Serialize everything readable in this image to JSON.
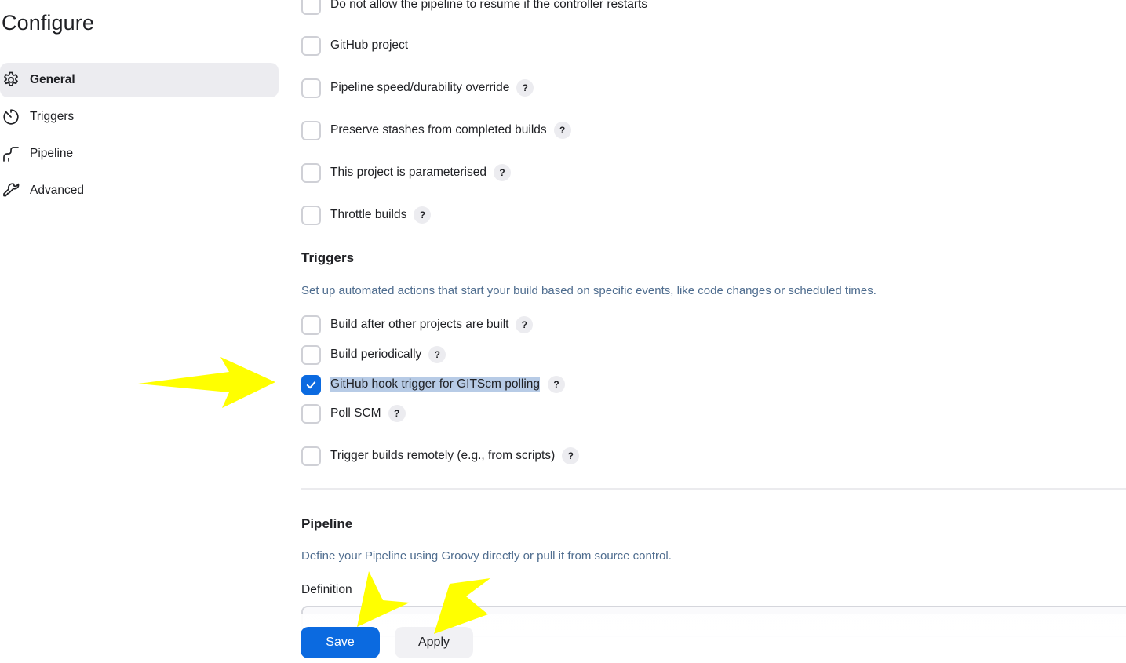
{
  "page": {
    "title": "Configure"
  },
  "sidebar": {
    "items": [
      {
        "label": "General",
        "icon": "gear-icon",
        "active": true
      },
      {
        "label": "Triggers",
        "icon": "timer-icon",
        "active": false
      },
      {
        "label": "Pipeline",
        "icon": "pipeline-icon",
        "active": false
      },
      {
        "label": "Advanced",
        "icon": "wrench-icon",
        "active": false
      }
    ]
  },
  "general": {
    "options": [
      {
        "label": "Do not allow the pipeline to resume if the controller restarts",
        "checked": false,
        "help": false
      },
      {
        "label": "GitHub project",
        "checked": false,
        "help": false
      },
      {
        "label": "Pipeline speed/durability override",
        "checked": false,
        "help": true
      },
      {
        "label": "Preserve stashes from completed builds",
        "checked": false,
        "help": true
      },
      {
        "label": "This project is parameterised",
        "checked": false,
        "help": true
      },
      {
        "label": "Throttle builds",
        "checked": false,
        "help": true
      }
    ]
  },
  "triggers": {
    "title": "Triggers",
    "description": "Set up automated actions that start your build based on specific events, like code changes or scheduled times.",
    "options": [
      {
        "label": "Build after other projects are built",
        "checked": false,
        "help": true
      },
      {
        "label": "Build periodically",
        "checked": false,
        "help": true
      },
      {
        "label": "GitHub hook trigger for GITScm polling",
        "checked": true,
        "help": true,
        "highlighted": true
      },
      {
        "label": "Poll SCM",
        "checked": false,
        "help": true
      },
      {
        "label": "Trigger builds remotely (e.g., from scripts)",
        "checked": false,
        "help": true
      }
    ]
  },
  "pipeline": {
    "title": "Pipeline",
    "description": "Define your Pipeline using Groovy directly or pull it from source control.",
    "definition_label": "Definition"
  },
  "help_glyph": "?",
  "actions": {
    "save_label": "Save",
    "apply_label": "Apply"
  },
  "colors": {
    "accent": "#0b6ae0",
    "annotation": "#ffff00",
    "description_text": "#4f6d8f",
    "selection": "#b7cbe6"
  }
}
